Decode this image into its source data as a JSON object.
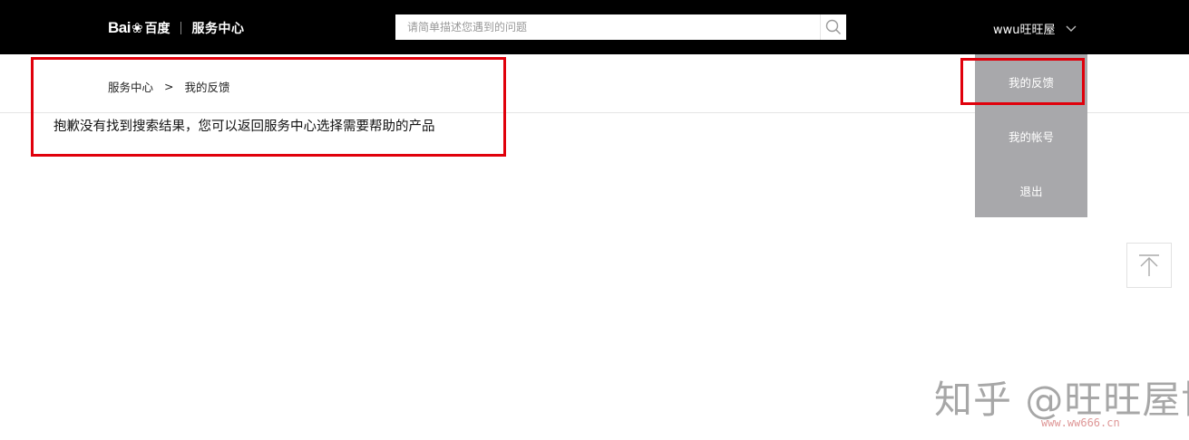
{
  "header": {
    "logo_bai": "Bai",
    "logo_paw": "❀",
    "logo_cn": "百度",
    "logo_service": "服务中心",
    "search_placeholder": "请简单描述您遇到的问题",
    "username": "wwu旺旺屋"
  },
  "breadcrumb": {
    "home": "服务中心",
    "separator": ">",
    "current": "我的反馈"
  },
  "main": {
    "message": "抱歉没有找到搜索结果，您可以返回服务中心选择需要帮助的产品"
  },
  "user_menu": {
    "items": [
      {
        "label": "我的反馈"
      },
      {
        "label": "我的帐号"
      },
      {
        "label": "退出"
      }
    ]
  },
  "watermark": {
    "text": "知乎 @旺旺屋博客",
    "url": "www.ww666.cn"
  },
  "colors": {
    "topbar": "#000000",
    "dropdown": "#a8a8ab",
    "highlight": "#e0000b"
  },
  "icons": {
    "search": "magnifier-icon",
    "user_menu": "chevron-down-icon",
    "back_to_top": "arrow-up-icon"
  }
}
